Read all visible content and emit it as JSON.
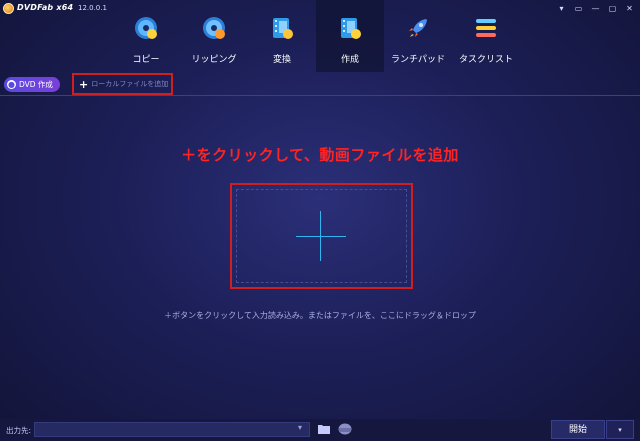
{
  "titlebar": {
    "app_name": "DVDFab x64",
    "version": "12.0.0.1",
    "controls": [
      "▾",
      "▭",
      "—",
      "▢",
      "✕"
    ]
  },
  "nav": {
    "tabs": [
      {
        "label": "コピー",
        "icon": "copy-disc-icon"
      },
      {
        "label": "リッピング",
        "icon": "ripper-disc-icon"
      },
      {
        "label": "変換",
        "icon": "converter-film-icon"
      },
      {
        "label": "作成",
        "icon": "creator-film-icon",
        "active": true
      },
      {
        "label": "ランチパッド",
        "icon": "rocket-icon"
      },
      {
        "label": "タスクリスト",
        "icon": "task-list-icon"
      }
    ]
  },
  "toolbar": {
    "dvd_create_label": "DVD 作成",
    "add_local_plus": "+",
    "add_local_label": "ローカルファイルを追加"
  },
  "main": {
    "instruction": "＋をクリックして、動画ファイルを追加",
    "hint": "＋ボタンをクリックして入力読み込み。またはファイルを、ここにドラッグ＆ドロップ"
  },
  "bottom": {
    "output_label": "出力先:",
    "output_value": "",
    "start_label": "開始",
    "dropdown_symbol": "▾",
    "caret_symbol": "▾"
  },
  "colors": {
    "accent_red": "#d11f1f",
    "plus_blue": "#2fb6f0",
    "background": "#1c1f57"
  }
}
